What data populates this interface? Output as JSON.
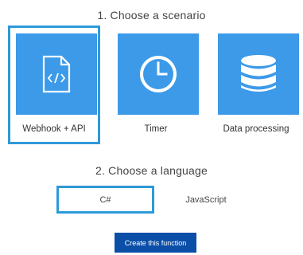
{
  "step1": {
    "title": "1. Choose a scenario",
    "scenarios": [
      {
        "label": "Webhook + API",
        "icon": "code-file-icon",
        "selected": true
      },
      {
        "label": "Timer",
        "icon": "clock-icon",
        "selected": false
      },
      {
        "label": "Data processing",
        "icon": "database-icon",
        "selected": false
      }
    ]
  },
  "step2": {
    "title": "2. Choose a language",
    "languages": [
      {
        "label": "C#",
        "selected": true
      },
      {
        "label": "JavaScript",
        "selected": false
      }
    ]
  },
  "create_button": {
    "label": "Create this function"
  },
  "colors": {
    "tile": "#3c9ae8",
    "selection_border": "#2e9ad8",
    "button": "#0a4ea8"
  }
}
